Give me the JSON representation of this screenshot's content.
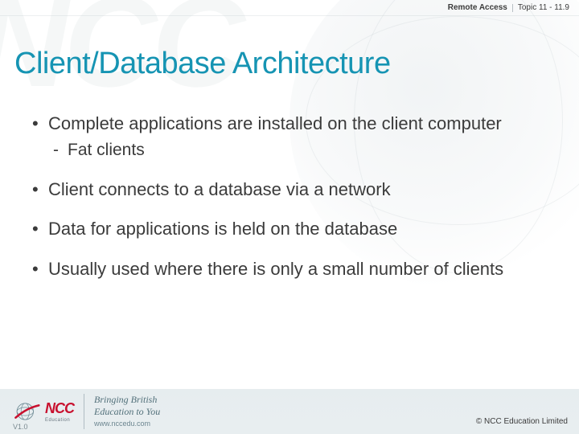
{
  "topbar": {
    "label_a": "Remote Access",
    "label_b": "Topic 11 - 11.9"
  },
  "title": "Client/Database Architecture",
  "bullets": [
    {
      "text": "Complete applications are installed on the client computer",
      "sub": [
        "Fat clients"
      ]
    },
    {
      "text": "Client connects to a database via a network"
    },
    {
      "text": "Data for applications is held on the database"
    },
    {
      "text": "Usually used where there is only a small number of clients"
    }
  ],
  "footer": {
    "logo_text": "NCC",
    "logo_sub": "Education",
    "tagline_l1": "Bringing British",
    "tagline_l2": "Education to You",
    "url": "www.nccedu.com",
    "version": "V1.0",
    "copyright": "©  NCC Education Limited"
  }
}
